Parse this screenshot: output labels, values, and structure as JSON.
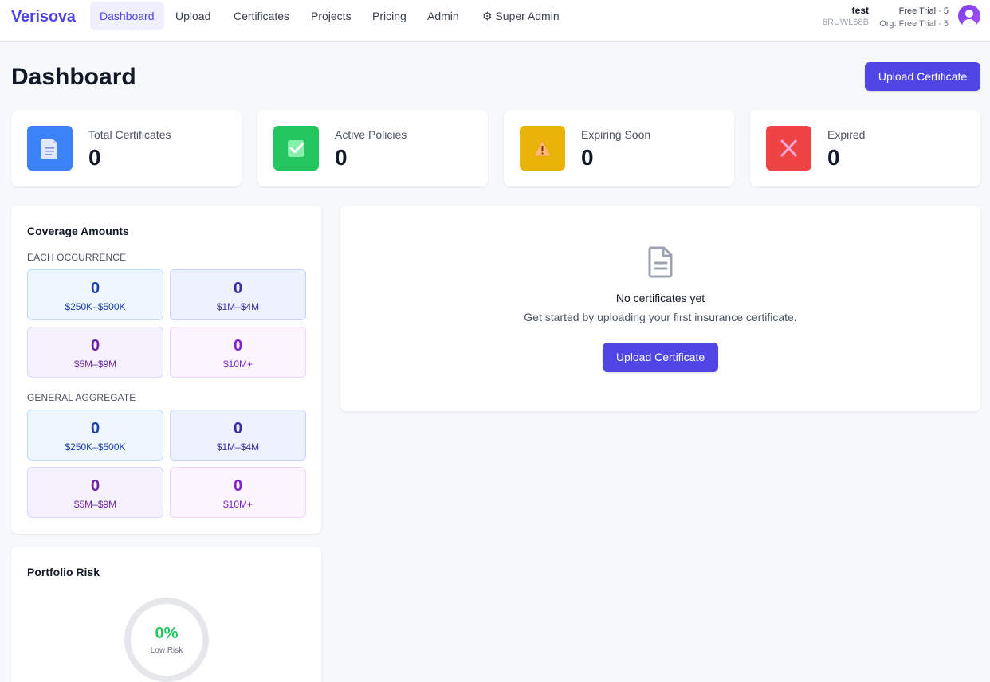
{
  "nav": {
    "brand": "Verisova",
    "links": [
      "Dashboard",
      "Upload",
      "Certificates",
      "Projects",
      "Pricing",
      "Admin",
      "⚙ Super Admin"
    ],
    "user": {
      "name": "test",
      "id": "6RUWL68B"
    },
    "plan": {
      "line1": "Free Trial · 5",
      "line2": "Org: Free Trial · 5"
    }
  },
  "header": {
    "title": "Dashboard",
    "upload_label": "Upload Certificate"
  },
  "stats": [
    {
      "label": "Total Certificates",
      "value": "0",
      "icon": "document-icon",
      "color": "#3b82f6"
    },
    {
      "label": "Active Policies",
      "value": "0",
      "icon": "check-icon",
      "color": "#22c55e"
    },
    {
      "label": "Expiring Soon",
      "value": "0",
      "icon": "warning-icon",
      "color": "#eab308"
    },
    {
      "label": "Expired",
      "value": "0",
      "icon": "x-icon",
      "color": "#ef4444"
    }
  ],
  "coverage": {
    "title": "Coverage Amounts",
    "each_occurrence": {
      "label": "EACH OCCURRENCE",
      "tiles": [
        {
          "count": "0",
          "range": "$250K–$500K"
        },
        {
          "count": "0",
          "range": "$1M–$4M"
        },
        {
          "count": "0",
          "range": "$5M–$9M"
        },
        {
          "count": "0",
          "range": "$10M+"
        }
      ]
    },
    "general_aggregate": {
      "label": "GENERAL AGGREGATE",
      "tiles": [
        {
          "count": "0",
          "range": "$250K–$500K"
        },
        {
          "count": "0",
          "range": "$1M–$4M"
        },
        {
          "count": "0",
          "range": "$5M–$9M"
        },
        {
          "count": "0",
          "range": "$10M+"
        }
      ]
    }
  },
  "empty_state": {
    "title": "No certificates yet",
    "subtitle": "Get started by uploading your first insurance certificate.",
    "button": "Upload Certificate"
  },
  "risk": {
    "title": "Portfolio Risk",
    "value": "0%",
    "label": "Low Risk",
    "color": "#22c55e"
  }
}
